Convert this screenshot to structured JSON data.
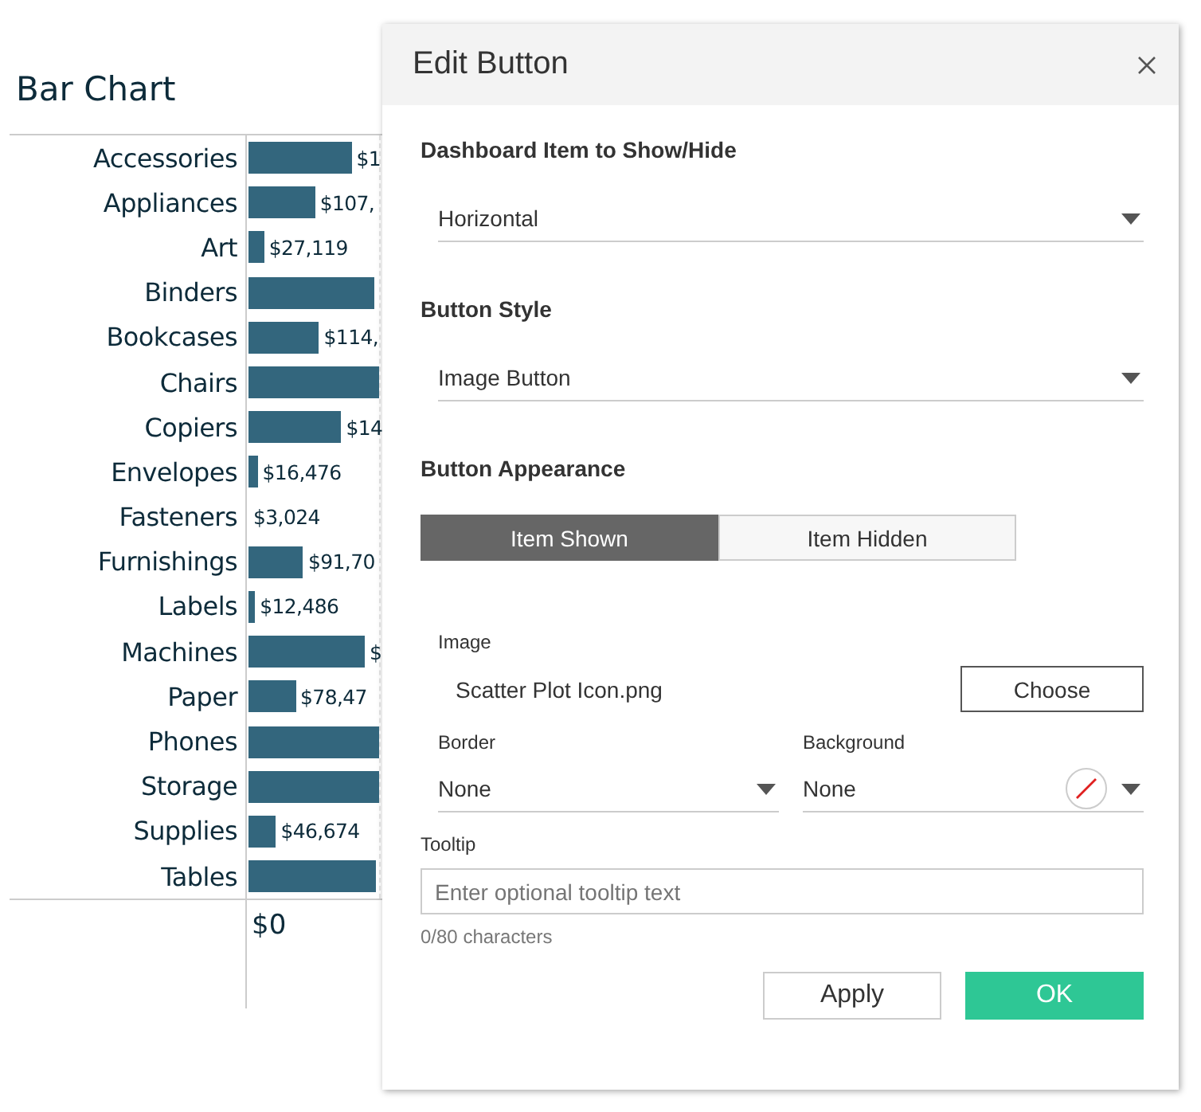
{
  "chart": {
    "title": "Bar Chart",
    "axis_tick": "$0",
    "rows": [
      {
        "category": "Accessories",
        "level": 0.79,
        "label": "$1"
      },
      {
        "category": "Appliances",
        "level": 0.51,
        "label": "$107,"
      },
      {
        "category": "Art",
        "level": 0.12,
        "label": "$27,119"
      },
      {
        "category": "Binders",
        "level": 0.96
      },
      {
        "category": "Bookcases",
        "level": 0.54,
        "label": "$114,"
      },
      {
        "category": "Chairs",
        "level": 1
      },
      {
        "category": "Copiers",
        "level": 0.71,
        "label": "$14"
      },
      {
        "category": "Envelopes",
        "level": 0.07,
        "label": "$16,476"
      },
      {
        "category": "Fasteners",
        "label": "$3,024"
      },
      {
        "category": "Furnishings",
        "level": 0.42,
        "label": "$91,70"
      },
      {
        "category": "Labels",
        "level": 0.05,
        "label": "$12,486"
      },
      {
        "category": "Machines",
        "level": 0.89,
        "label": "$"
      },
      {
        "category": "Paper",
        "level": 0.36,
        "label": "$78,47"
      },
      {
        "category": "Phones",
        "level": 1
      },
      {
        "category": "Storage",
        "level": 1
      },
      {
        "category": "Supplies",
        "level": 0.21,
        "label": "$46,674"
      },
      {
        "category": "Tables",
        "level": 0.98
      }
    ]
  },
  "dialog": {
    "title": "Edit Button",
    "item_heading": "Dashboard Item to Show/Hide",
    "item_value": "Horizontal",
    "style_heading": "Button Style",
    "style_value": "Image Button",
    "appearance_heading": "Button Appearance",
    "toggle": [
      {
        "label": "Item Shown",
        "selected": true
      },
      {
        "label": "Item Hidden",
        "selected": false
      }
    ],
    "image_label": "Image",
    "image_file": "Scatter Plot Icon.png",
    "choose_button": "Choose",
    "border_label": "Border",
    "border_value": "None",
    "background_label": "Background",
    "background_value": "None",
    "tooltip_label": "Tooltip",
    "tooltip_placeholder": "Enter optional tooltip text",
    "char_count": "0/80 characters",
    "buttons": [
      {
        "label": "Apply",
        "kind": "secondary"
      },
      {
        "label": "OK",
        "kind": "primary"
      }
    ]
  }
}
